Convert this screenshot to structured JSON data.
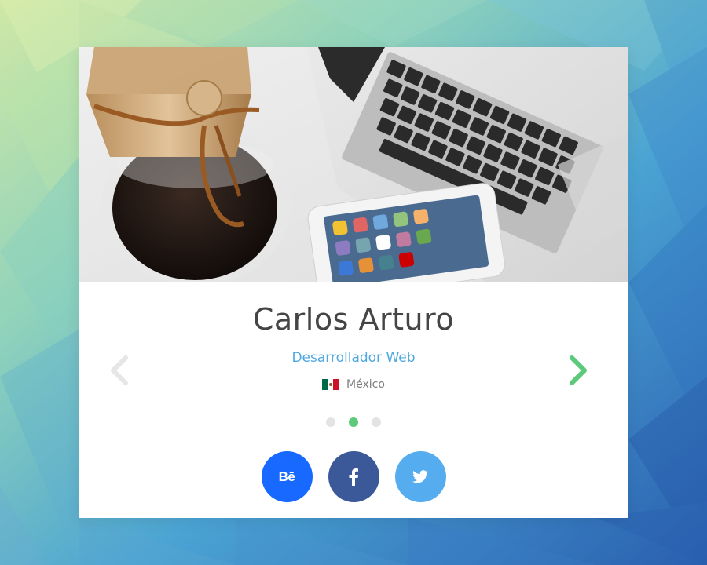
{
  "profile": {
    "name": "Carlos Arturo",
    "role": "Desarrollador Web",
    "country": "México"
  },
  "colors": {
    "role": "#4fa8e0",
    "active_dot": "#5dc97a",
    "inactive_dot": "#e3e3e3",
    "next_arrow": "#5dc97a",
    "prev_arrow": "#e6e6e6",
    "behance": "#1769ff",
    "facebook": "#3b5998",
    "twitter": "#55acee"
  },
  "carousel": {
    "dots": [
      {
        "state": "inactive"
      },
      {
        "state": "active"
      },
      {
        "state": "inactive"
      }
    ]
  },
  "social": {
    "items": [
      {
        "name": "behance",
        "label": "Bē"
      },
      {
        "name": "facebook",
        "icon": "facebook-icon"
      },
      {
        "name": "twitter",
        "icon": "twitter-icon"
      }
    ]
  },
  "icons": {
    "prev": "chevron-left-icon",
    "next": "chevron-right-icon",
    "flag": "mexico-flag-icon"
  }
}
